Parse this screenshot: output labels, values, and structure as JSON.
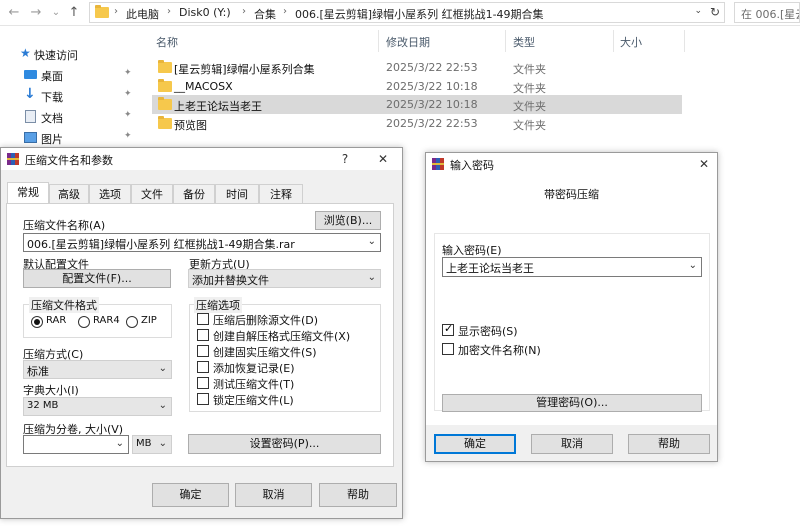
{
  "explorer": {
    "nav": {
      "back": "←",
      "forward": "→",
      "dropdown": "⌄",
      "up": "↑"
    },
    "breadcrumbs": [
      "此电脑",
      "Disk0 (Y:)",
      "合集",
      "006.[星云剪辑]绿帽小屋系列 红框挑战1-49期合集"
    ],
    "breadcrumb_sep": "›",
    "address_dropdown": "⌄",
    "refresh": "↻",
    "search_placeholder": "在 006.[星云",
    "sidebar": [
      {
        "label": "快速访问",
        "icon": "star-icon"
      },
      {
        "label": "桌面",
        "icon": "desktop-icon"
      },
      {
        "label": "下载",
        "icon": "download-icon"
      },
      {
        "label": "文档",
        "icon": "documents-icon"
      },
      {
        "label": "图片",
        "icon": "pictures-icon"
      }
    ],
    "pin_glyph": "📌",
    "columns": {
      "name": "名称",
      "date": "修改日期",
      "type": "类型",
      "size": "大小"
    },
    "files": [
      {
        "name": "[星云剪辑]绿帽小屋系列合集",
        "date": "2025/3/22 22:53",
        "type": "文件夹"
      },
      {
        "name": "__MACOSX",
        "date": "2025/3/22 10:18",
        "type": "文件夹"
      },
      {
        "name": "上老王论坛当老王",
        "date": "2025/3/22 10:18",
        "type": "文件夹"
      },
      {
        "name": "预览图",
        "date": "2025/3/22 22:53",
        "type": "文件夹"
      }
    ]
  },
  "archive_dialog": {
    "title": "压缩文件名和参数",
    "help_glyph": "?",
    "close_glyph": "✕",
    "tabs": [
      "常规",
      "高级",
      "选项",
      "文件",
      "备份",
      "时间",
      "注释"
    ],
    "archive_name_label": "压缩文件名称(A)",
    "browse_button": "浏览(B)...",
    "archive_name_value": "006.[星云剪辑]绿帽小屋系列 红框挑战1-49期合集.rar",
    "default_profile_label": "默认配置文件",
    "profile_button": "配置文件(F)...",
    "update_mode_label": "更新方式(U)",
    "update_mode_value": "添加并替换文件",
    "format_group": "压缩文件格式",
    "formats": [
      "RAR",
      "RAR4",
      "ZIP"
    ],
    "options_group": "压缩选项",
    "options": [
      "压缩后删除源文件(D)",
      "创建自解压格式压缩文件(X)",
      "创建固实压缩文件(S)",
      "添加恢复记录(E)",
      "测试压缩文件(T)",
      "锁定压缩文件(L)"
    ],
    "method_label": "压缩方式(C)",
    "method_value": "标准",
    "dict_label": "字典大小(I)",
    "dict_value": "32 MB",
    "split_label": "压缩为分卷, 大小(V)",
    "split_value": "",
    "split_unit": "MB",
    "set_password_button": "设置密码(P)...",
    "ok": "确定",
    "cancel": "取消",
    "help": "帮助",
    "arrow": "⌄"
  },
  "password_dialog": {
    "title": "输入密码",
    "close_glyph": "✕",
    "heading": "带密码压缩",
    "enter_label": "输入密码(E)",
    "password_value": "上老王论坛当老王",
    "show_password": "显示密码(S)",
    "encrypt_names": "加密文件名称(N)",
    "manage_button": "管理密码(O)...",
    "ok": "确定",
    "cancel": "取消",
    "help": "帮助",
    "arrow": "⌄"
  }
}
